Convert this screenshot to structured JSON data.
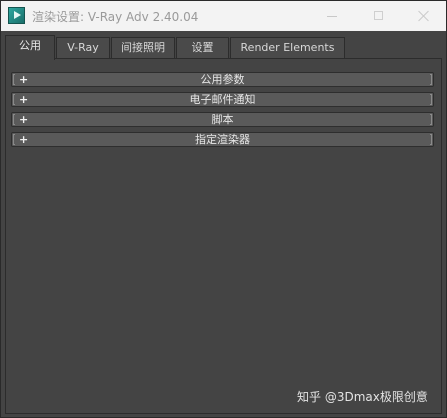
{
  "window": {
    "title": "渲染设置: V-Ray Adv 2.40.04",
    "icon": "3dsmax-app-icon"
  },
  "tabs": [
    {
      "label": "公用",
      "active": true
    },
    {
      "label": "V-Ray",
      "active": false
    },
    {
      "label": "间接照明",
      "active": false
    },
    {
      "label": "设置",
      "active": false
    },
    {
      "label": "Render Elements",
      "active": false
    }
  ],
  "rollouts": [
    {
      "label": "公用参数",
      "expand_symbol": "+"
    },
    {
      "label": "电子邮件通知",
      "expand_symbol": "+"
    },
    {
      "label": "脚本",
      "expand_symbol": "+"
    },
    {
      "label": "指定渲染器",
      "expand_symbol": "+"
    }
  ],
  "watermark": "知乎 @3Dmax极限创意",
  "colors": {
    "titlebar_bg": "#f3f3f3",
    "panel_bg": "#444444",
    "rollout_bg": "#5a5a5a",
    "text": "#e6e6e6"
  }
}
